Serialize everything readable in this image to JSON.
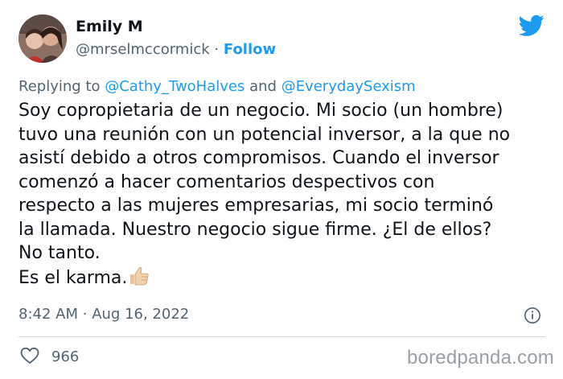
{
  "author": {
    "display_name": "Emily M",
    "handle": "@mrselmccormick",
    "separator": "·",
    "follow_label": "Follow"
  },
  "reply": {
    "prefix": "Replying to",
    "mention_1": "@Cathy_TwoHalves",
    "conjunction": "and",
    "mention_2": "@EverydaySexism"
  },
  "tweet": {
    "text": "Soy copropietaria de un negocio. Mi socio (un hombre)\ntuvo una reunión con un potencial inversor, a la que no\nasistí debido a otros compromisos. Cuando el inversor\ncomenzó a hacer comentarios despectivos con\nrespecto a las mujeres empresarias, mi socio terminó\nla llamada. Nuestro negocio sigue firme. ¿El de ellos?\nNo tanto.\nEs el karma.",
    "emoji": "thumbs-up-icon"
  },
  "meta": {
    "time": "8:42 AM",
    "separator": "·",
    "date": "Aug 16, 2022"
  },
  "engagement": {
    "likes": "966"
  },
  "watermark": "boredpanda.com",
  "colors": {
    "accent": "#1d9bf0",
    "secondary_text": "#536471",
    "divider": "#cfd9de"
  }
}
